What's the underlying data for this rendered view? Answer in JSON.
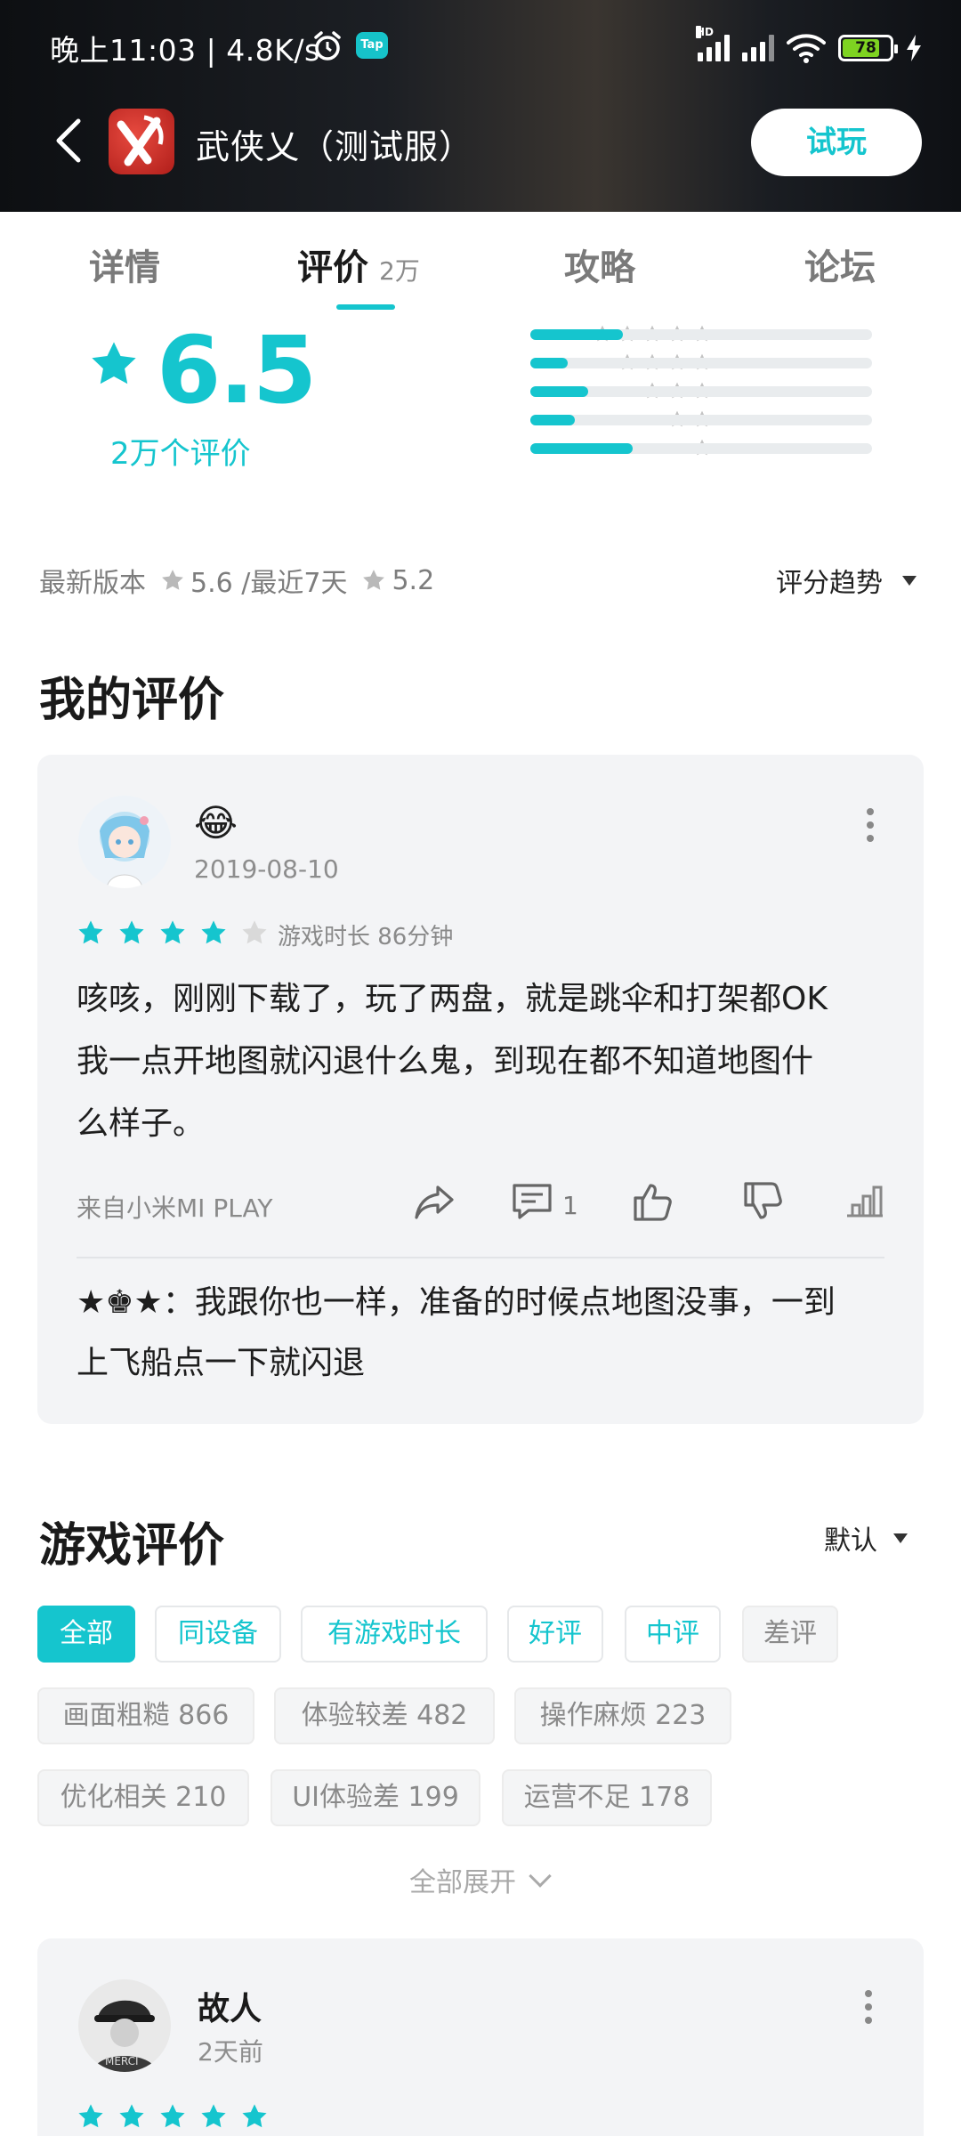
{
  "status_bar": {
    "time_speed": "晚上11:03 | 4.8K/s",
    "tap_badge": "Tap",
    "hd_label": "HD",
    "battery": "78"
  },
  "header": {
    "app_title": "武侠乂（测试服）",
    "try_button": "试玩"
  },
  "tabs": [
    {
      "label": "详情",
      "count": ""
    },
    {
      "label": "评价",
      "count": "2万"
    },
    {
      "label": "攻略",
      "count": ""
    },
    {
      "label": "论坛",
      "count": ""
    }
  ],
  "rating": {
    "score": "6.5",
    "count_label": "2万个评价",
    "distribution": [
      {
        "stars": 5,
        "fraction": 0.27
      },
      {
        "stars": 4,
        "fraction": 0.11
      },
      {
        "stars": 3,
        "fraction": 0.17
      },
      {
        "stars": 2,
        "fraction": 0.13
      },
      {
        "stars": 1,
        "fraction": 0.3
      }
    ],
    "latest_version_label": "最新版本",
    "latest_version_score": "5.6 /最近7天",
    "recent_score": "5.2",
    "trend_label": "评分趋势"
  },
  "my_review": {
    "section_title": "我的评价",
    "emoji": "😂",
    "date": "2019-08-10",
    "stars": 4,
    "playtime": "游戏时长 86分钟",
    "text_lines": [
      "咳咳，刚刚下载了，玩了两盘，就是跳伞和打架都OK",
      "我一点开地图就闪退什么鬼，到现在都不知道地图什",
      "么样子。"
    ],
    "source": "来自小米MI PLAY",
    "comment_count": "1",
    "reply_lines": [
      "★♚★：我跟你也一样，准备的时候点地图没事，一到",
      "上飞船点一下就闪退"
    ]
  },
  "game_reviews": {
    "section_title": "游戏评价",
    "sort_label": "默认",
    "filters": [
      "全部",
      "同设备",
      "有游戏时长",
      "好评",
      "中评",
      "差评"
    ],
    "tags_row1": [
      "画面粗糙 866",
      "体验较差 482",
      "操作麻烦 223"
    ],
    "tags_row2": [
      "优化相关 210",
      "UI体验差 199",
      "运营不足 178"
    ],
    "expand_label": "全部展开"
  },
  "review2": {
    "name": "故人",
    "time": "2天前",
    "stars": 5
  },
  "colors": {
    "accent": "#15c5ce",
    "card": "#f3f4f6"
  }
}
